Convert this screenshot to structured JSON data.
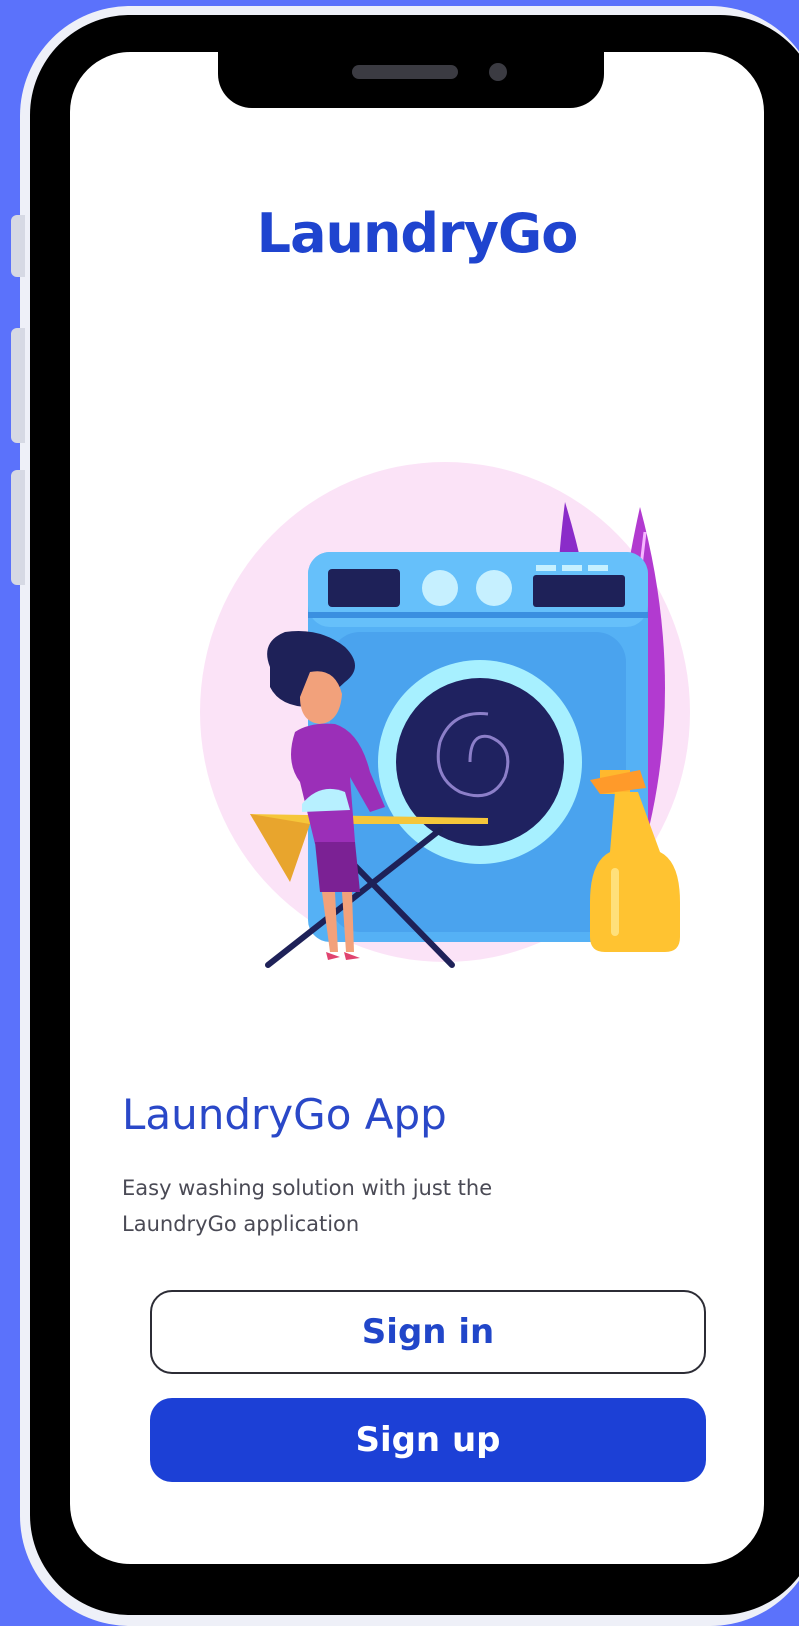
{
  "app": {
    "logo_text": "LaundryGo",
    "title": "LaundryGo App",
    "subtitle": "Easy washing solution with just the LaundryGo application"
  },
  "actions": {
    "sign_in_label": "Sign in",
    "sign_up_label": "Sign up"
  },
  "illustration": {
    "description_icon": "laundry-illustration"
  },
  "colors": {
    "background": "#5b72fb",
    "brand": "#1f44cf",
    "primary_button": "#1c40d6"
  }
}
